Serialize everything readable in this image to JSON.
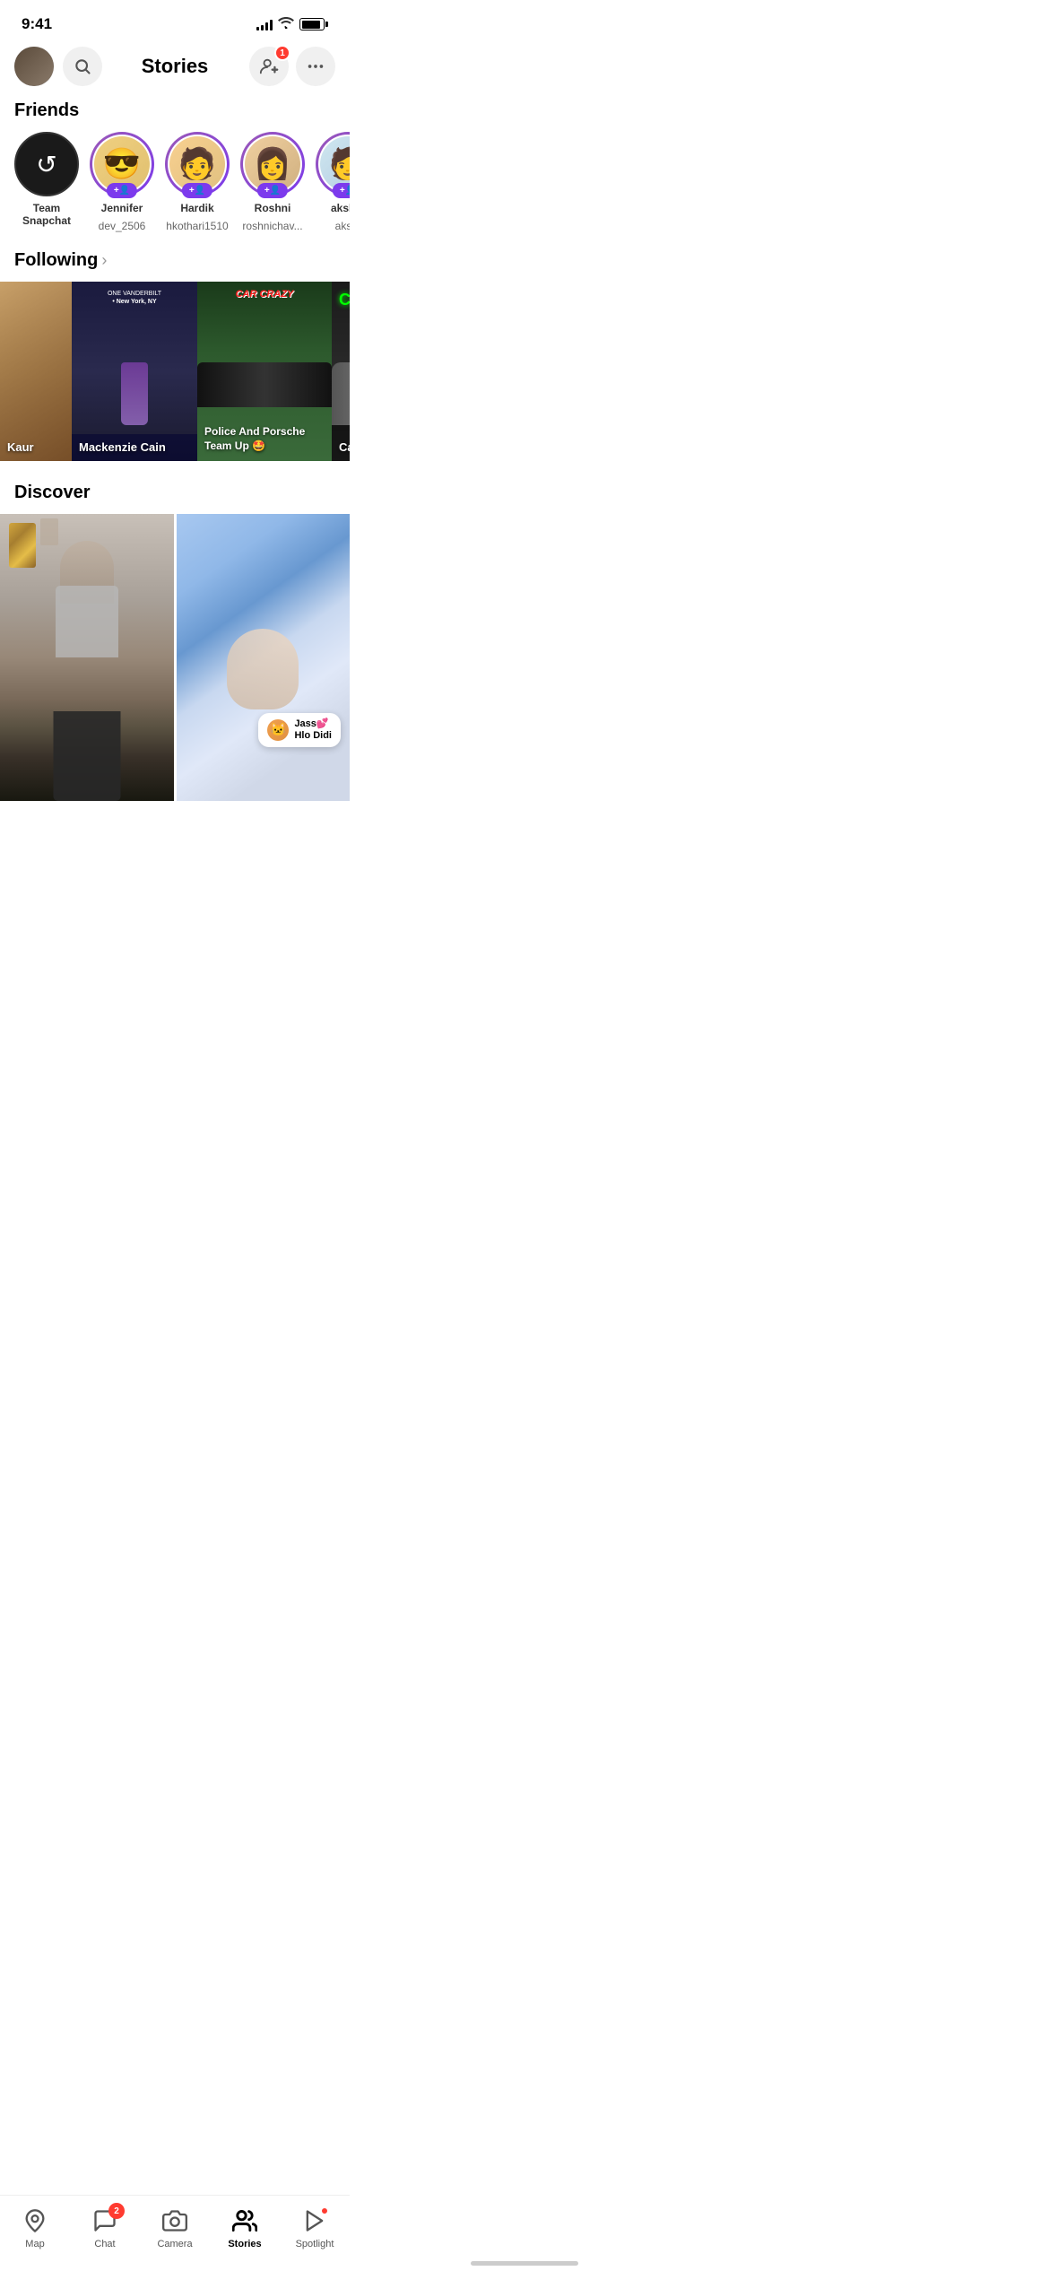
{
  "statusBar": {
    "time": "9:41",
    "signalBars": [
      4,
      6,
      8,
      10,
      12
    ],
    "batteryPercent": 90
  },
  "header": {
    "title": "Stories",
    "notificationCount": "1",
    "addFriendLabel": "add-friend",
    "moreLabel": "more"
  },
  "friends": {
    "sectionTitle": "Friends",
    "items": [
      {
        "id": "team-snapchat",
        "name": "Team Snapchat",
        "username": "",
        "hasStory": false,
        "emoji": "🔄"
      },
      {
        "id": "jennifer",
        "name": "Jennifer",
        "username": "dev_2506",
        "hasStory": true,
        "emoji": "😎"
      },
      {
        "id": "hardik",
        "name": "Hardik",
        "username": "hkothari1510",
        "hasStory": true,
        "emoji": "🧑"
      },
      {
        "id": "roshni",
        "name": "Roshni",
        "username": "roshnichav...",
        "hasStory": true,
        "emoji": "👩"
      },
      {
        "id": "akshat",
        "name": "Ak",
        "username": "aks...",
        "hasStory": true,
        "emoji": "🧑"
      }
    ],
    "addFriendLabel": "+👤"
  },
  "following": {
    "sectionTitle": "Following",
    "items": [
      {
        "id": "kaur",
        "name": "Kaur",
        "title": "",
        "location": ""
      },
      {
        "id": "mackenzie",
        "name": "Mackenzie Cain",
        "title": "",
        "location": "ONE VANDERBILT • New York, NY"
      },
      {
        "id": "police",
        "name": "Car Crazy",
        "title": "Police And Porsche Team Up 🤩",
        "location": ""
      },
      {
        "id": "cars",
        "name": "Car Show Regrets",
        "title": "Car Show Regrets",
        "location": ""
      }
    ]
  },
  "discover": {
    "sectionTitle": "Discover",
    "items": [
      {
        "id": "discover-1",
        "label": ""
      },
      {
        "id": "discover-2",
        "sticker": {
          "name": "Jass💕",
          "subtitle": "Hlo Didi"
        }
      }
    ]
  },
  "bottomNav": {
    "items": [
      {
        "id": "map",
        "label": "Map",
        "icon": "map",
        "active": false,
        "badge": 0
      },
      {
        "id": "chat",
        "label": "Chat",
        "icon": "chat",
        "active": false,
        "badge": 2
      },
      {
        "id": "camera",
        "label": "Camera",
        "icon": "camera",
        "active": false,
        "badge": 0
      },
      {
        "id": "stories",
        "label": "Stories",
        "icon": "stories",
        "active": true,
        "badge": 0
      },
      {
        "id": "spotlight",
        "label": "Spotlight",
        "icon": "spotlight",
        "active": false,
        "badge": 1
      }
    ]
  }
}
